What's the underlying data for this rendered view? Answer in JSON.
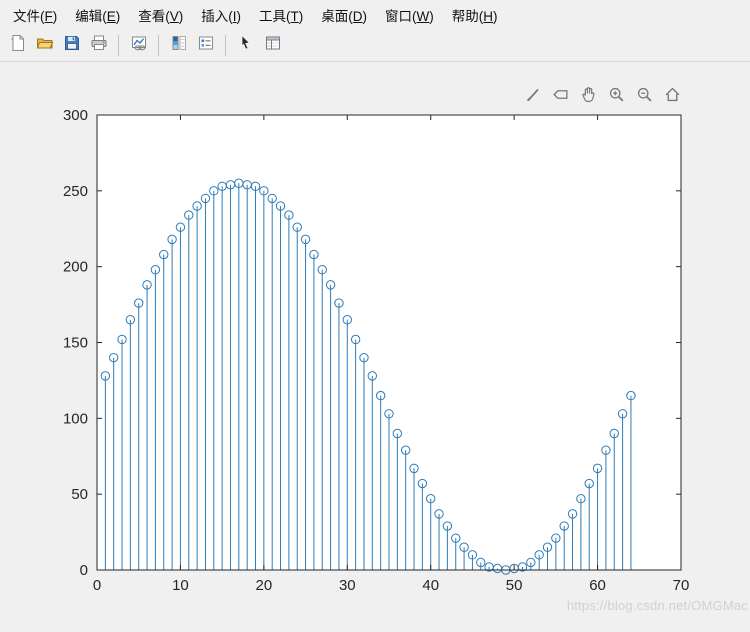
{
  "menu": {
    "items": [
      {
        "label": "文件",
        "mnemonic": "F"
      },
      {
        "label": "编辑",
        "mnemonic": "E"
      },
      {
        "label": "查看",
        "mnemonic": "V"
      },
      {
        "label": "插入",
        "mnemonic": "I"
      },
      {
        "label": "工具",
        "mnemonic": "T"
      },
      {
        "label": "桌面",
        "mnemonic": "D"
      },
      {
        "label": "窗口",
        "mnemonic": "W"
      },
      {
        "label": "帮助",
        "mnemonic": "H"
      }
    ]
  },
  "toolbar": {
    "buttons": [
      {
        "icon": "new-figure"
      },
      {
        "icon": "open-file"
      },
      {
        "icon": "save-figure"
      },
      {
        "icon": "print-figure"
      },
      {
        "icon": "link-plot"
      },
      {
        "icon": "insert-colorbar"
      },
      {
        "icon": "insert-legend"
      },
      {
        "icon": "edit-plot"
      },
      {
        "icon": "property-inspector"
      }
    ]
  },
  "axes_toolbar": {
    "buttons": [
      {
        "icon": "brush"
      },
      {
        "icon": "data-tips"
      },
      {
        "icon": "pan"
      },
      {
        "icon": "zoom-in"
      },
      {
        "icon": "zoom-out"
      },
      {
        "icon": "restore-view"
      }
    ]
  },
  "watermark": {
    "text": "https://blog.csdn.net/OMGMac"
  },
  "chart_data": {
    "type": "stem",
    "title": "",
    "xlabel": "",
    "ylabel": "",
    "x": [
      1,
      2,
      3,
      4,
      5,
      6,
      7,
      8,
      9,
      10,
      11,
      12,
      13,
      14,
      15,
      16,
      17,
      18,
      19,
      20,
      21,
      22,
      23,
      24,
      25,
      26,
      27,
      28,
      29,
      30,
      31,
      32,
      33,
      34,
      35,
      36,
      37,
      38,
      39,
      40,
      41,
      42,
      43,
      44,
      45,
      46,
      47,
      48,
      49,
      50,
      51,
      52,
      53,
      54,
      55,
      56,
      57,
      58,
      59,
      60,
      61,
      62,
      63,
      64
    ],
    "values": [
      128,
      140,
      152,
      165,
      176,
      188,
      198,
      208,
      218,
      226,
      234,
      240,
      245,
      250,
      253,
      254,
      255,
      254,
      253,
      250,
      245,
      240,
      234,
      226,
      218,
      208,
      198,
      188,
      176,
      165,
      152,
      140,
      128,
      115,
      103,
      90,
      79,
      67,
      57,
      47,
      37,
      29,
      21,
      15,
      10,
      5,
      2,
      1,
      0,
      1,
      2,
      5,
      10,
      15,
      21,
      29,
      37,
      47,
      57,
      67,
      79,
      90,
      103,
      115
    ],
    "xlim": [
      0,
      70
    ],
    "ylim": [
      0,
      300
    ],
    "xticks": [
      0,
      10,
      20,
      30,
      40,
      50,
      60,
      70
    ],
    "yticks": [
      0,
      50,
      100,
      150,
      200,
      250,
      300
    ],
    "marker": "circle",
    "marker_filled": false,
    "line_color": "#2e7bb6",
    "axis_color": "#262626",
    "grid": false,
    "legend": null
  }
}
